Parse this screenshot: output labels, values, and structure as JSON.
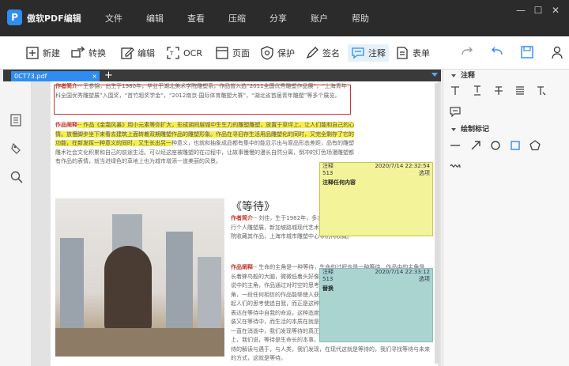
{
  "app": {
    "name": "傲软PDF编辑",
    "logo_letter": "P"
  },
  "menu": [
    "文件",
    "编辑",
    "查看",
    "压缩",
    "分享",
    "账户",
    "帮助"
  ],
  "window_controls": [
    "—",
    "☐",
    "✕"
  ],
  "toolbar": {
    "items": [
      {
        "label": "新建",
        "icon": "plus-square-icon"
      },
      {
        "label": "转换",
        "icon": "convert-icon"
      },
      {
        "label": "编辑",
        "icon": "edit-icon"
      },
      {
        "label": "OCR",
        "icon": "ocr-icon"
      },
      {
        "label": "页面",
        "icon": "page-icon"
      },
      {
        "label": "保护",
        "icon": "shield-icon"
      },
      {
        "label": "签名",
        "icon": "pen-icon"
      },
      {
        "label": "注释",
        "icon": "comment-icon"
      },
      {
        "label": "表单",
        "icon": "form-icon"
      }
    ],
    "active": "注释"
  },
  "tabs": [
    {
      "label": "0CT73.pdf",
      "close": "×"
    }
  ],
  "tab_add": "+",
  "document": {
    "para1_label": "作者简介",
    "para1_text": "-- 王参锦，出生于1980年，毕业于湖北美术学院雕塑系，作品曾入选“2011全国优秀雕塑作品展”，“上海青年科全国优秀雕塑展”入围奖，“首竹超奖学金”，“2012南京·国际体育雕塑大赛”，“湖北省首届青年雕塑”等多个展览。",
    "para2_label": "作品阐释",
    "para2_hl": "-- 作品《金霜风暴》用小元素等你扩大，形成胡同层城中生生力的雕塑雕塑，放置于草坪上，让人们能和自己的心情。放慢脚步坐下来看去建筑上面转着双期雕塑作品的雕塑形象。作品在寻旧存生活用品雕塑化的同时，又完全剩存了它的功能，在新发挥一种意义的同时，又生长出另一",
    "para2_rest": "种意义，也就和抽象成品都有集中的能显示出与原品形态差距，品有的雕塑雕术社会文化积累和自己的前途生活。可以经这座被雕塑的在过程中，让故事慢慢的漫长自然分离，倒冲的灯色场漫雕塑都有作品的表情，就当进绿色的草地上也为城市增添一道美丽的风景。",
    "title2": "《等待》",
    "para3_label": "作者简介",
    "para3_text": "-- 刘佳，生于1982年，多次参加国内外重要展览，法国ValiAcio雕塑举行个人雕塑展，新加坡路城现代艺术馆、深圳美术馆、重庆美术馆、法国国立雕塑院收藏其作品，上海市城市雕塑中心等机构收藏。",
    "para4_label": "作品阐释",
    "para4_text": "-- 生命的主角是一种等待，生命的过程也是一种等待，作品中的主角是长着蜂鸟般的大脑，微微低着头好像正在思考人生中某种时机，来自文化遗留的传说中的主角，作品通过对时空的思考，表达出人类个体在生存，许多人生命中的主角，一段任何相信的作品能够使人获得生存唯一目的就是等待某种事物的到来，引起人们的思考使追自我，而正是这种社会结束，正如存在主义的基本原则，作品在表达在等待中自我的命运，这种态度正是这种对自己寻找理由的一样，但生活的然装又在等待中，而生活的本质在就是对这一生命的一种态度的思考，这是个意义，一直在消逝中，我们发现等待的真正本质，所以等待本身就是这个真正的，本质上，我们说，等待是生命长的本事，来往的现及可安于不要之上与生存一同承受等待的解读与遇于，与人类，我们发现，在现代这就是等待的，我们寻找等待与未来的方式，这就是等待。"
  },
  "notes": [
    {
      "title": "注释",
      "date": "2020/7/14 22:32:54",
      "num": "513",
      "action": "选项",
      "body": "注释任何内容"
    },
    {
      "title": "注释",
      "date": "2020/7/14 22:33:12",
      "num": "513",
      "action": "选项",
      "body": "替换"
    }
  ],
  "right_panel": {
    "section1": "注释",
    "section2": "绘制标记"
  },
  "colors": {
    "accent": "#2f8cf0",
    "titlebar": "#2b2b2b",
    "highlight": "#f7ef4a",
    "note_yellow": "#f3f39a",
    "note_teal": "#a9d4d0"
  }
}
